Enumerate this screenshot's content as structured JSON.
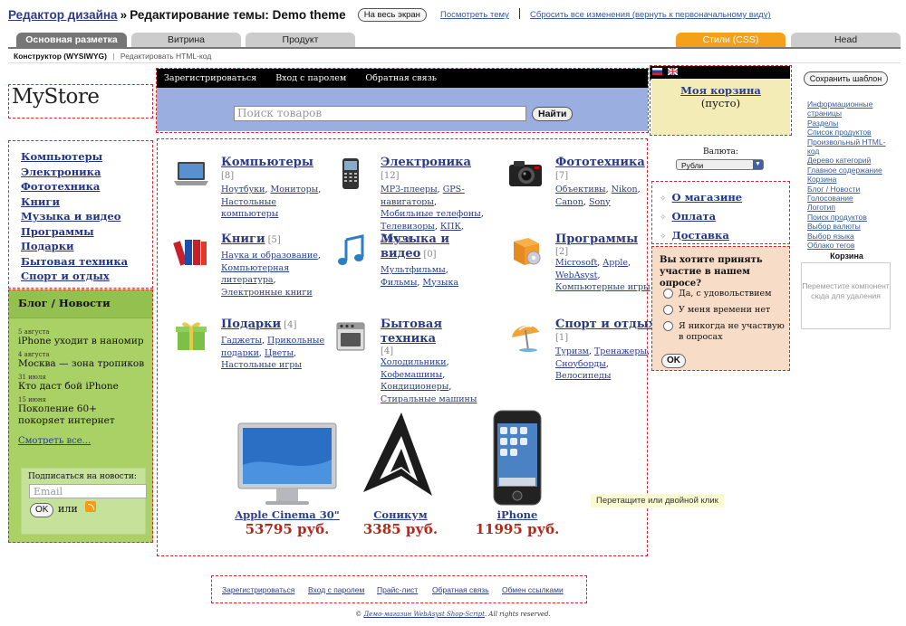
{
  "header": {
    "breadcrumb": "Редактор дизайна",
    "separator": "»",
    "title": "Редактирование темы: Demo theme",
    "fullscreen_label": "На весь экран",
    "view_theme_label": "Посмотреть тему",
    "reset_label": "Сбросить все изменения (вернуть к первоначальному виду)"
  },
  "tabs": [
    {
      "label": "Основная разметка"
    },
    {
      "label": "Витрина"
    },
    {
      "label": "Продукт"
    },
    {
      "label": "Стили (CSS)"
    },
    {
      "label": "Head"
    }
  ],
  "subtabs": {
    "wysiwyg": "Конструктор (WYSIWYG)",
    "sep": "|",
    "html": "Редактировать HTML-код"
  },
  "store": {
    "logo": "MyStore",
    "left_categories": [
      "Компьютеры",
      "Электроника",
      "Фототехника",
      "Книги",
      "Музыка и видео",
      "Программы",
      "Подарки",
      "Бытовая техника",
      "Спорт и отдых"
    ],
    "blog": {
      "title": "Блог / Новости",
      "entries": [
        {
          "date": "5 августа",
          "title": "iPhone уходит в наномир"
        },
        {
          "date": "4 августа",
          "title": "Москва — зона тропиков"
        },
        {
          "date": "31 июля",
          "title": "Кто даст бой iPhone"
        },
        {
          "date": "15 июня",
          "title": "Поколение 60+ покоряет интернет"
        }
      ],
      "see_all": "Смотреть все...",
      "subscribe_label": "Подписаться на новости:",
      "email_placeholder": "Email",
      "ok_label": "OK",
      "or_label": "или"
    },
    "top_nav": [
      "Зарегистрироваться",
      "Вход с паролем",
      "Обратная связь"
    ],
    "search": {
      "placeholder": "Поиск товаров",
      "button": "Найти"
    },
    "categories": [
      {
        "name": "Компьютеры",
        "count": "[8]",
        "subs": [
          "Ноутбуки",
          ", ",
          "Мониторы",
          ", ",
          "Настольные компьютеры"
        ],
        "icon": "laptop-icon"
      },
      {
        "name": "Электроника",
        "count": "[12]",
        "subs": [
          "MP3-плееры",
          ", ",
          "GPS-навигаторы",
          ", ",
          "Мобильные телефоны",
          ", ",
          "Телевизоры",
          ", ",
          "КПК",
          ", ",
          "Другое"
        ],
        "icon": "mobile-phone-icon"
      },
      {
        "name": "Фототехника",
        "count": "[7]",
        "subs": [
          "Объективы",
          ", ",
          "Nikon",
          ", ",
          "Canon",
          ", ",
          "Sony"
        ],
        "icon": "camera-icon"
      },
      {
        "name": "Книги",
        "count": "[5]",
        "subs": [
          "Наука и образование",
          ", ",
          "Компьютерная литература",
          ", ",
          "Электронные книги"
        ],
        "icon": "books-icon"
      },
      {
        "name": "Музыка и видео",
        "count": "[0]",
        "subs": [
          "Мультфильмы",
          ", ",
          "Фильмы",
          ", ",
          "Музыка"
        ],
        "icon": "music-note-icon"
      },
      {
        "name": "Программы",
        "count": "[2]",
        "subs": [
          "Microsoft",
          ", ",
          "Apple",
          ", ",
          "WebAsyst",
          ", ",
          "Компьютерные игры"
        ],
        "icon": "software-box-icon"
      },
      {
        "name": "Подарки",
        "count": "[4]",
        "subs": [
          "Гаджеты",
          ", ",
          "Прикольные подарки",
          ", ",
          "Цветы",
          ", ",
          "Настольные игры"
        ],
        "icon": "gift-icon"
      },
      {
        "name": "Бытовая техника",
        "count": "[4]",
        "subs": [
          "Холодильники",
          ", ",
          "Кофемашины",
          ", ",
          "Кондиционеры",
          ", ",
          "Стиральные машины"
        ],
        "icon": "stove-icon"
      },
      {
        "name": "Спорт и отдых",
        "count": "[1]",
        "subs": [
          "Туризм",
          ", ",
          "Тренажеры",
          ", ",
          "Сноуборды",
          ", ",
          "Велосипеды"
        ],
        "icon": "beach-umbrella-icon"
      }
    ],
    "products": [
      {
        "name": "Apple Cinema 30\"",
        "price": "53795 руб."
      },
      {
        "name": "Соникум",
        "price": "3385 руб."
      },
      {
        "name": "iPhone",
        "price": "11995 руб."
      }
    ],
    "drag_tip": "Перетащите или двойной клик",
    "cart": {
      "title": "Моя корзина",
      "empty": "(пусто)"
    },
    "currency": {
      "label": "Валюта:",
      "selected": "Рубли"
    },
    "info_pages": [
      "О магазине",
      "Оплата",
      "Доставка"
    ],
    "poll": {
      "question": "Вы хотите принять участие в нашем опросе?",
      "options": [
        "Да, с удовольствием",
        "У меня времени нет",
        "Я никогда не участвую в опросах"
      ],
      "ok_label": "OK"
    },
    "footer_nav": [
      "Зарегистрироваться",
      "Вход с паролем",
      "Прайс-лист",
      "Обратная связь",
      "Обмен ссылками"
    ],
    "copyright_prefix": "©",
    "copyright_link": "Демо-магазин WebAsyst Shop-Script",
    "copyright_suffix": ". All rights reserved."
  },
  "sidebar": {
    "save_label": "Сохранить шаблон",
    "widgets": [
      "Информационные страницы",
      "Разделы",
      "Список продуктов",
      "Произвольный HTML-код",
      "Дерево категорий",
      "Главное содержание",
      "Корзина",
      "Блог / Новости",
      "Голосование",
      "Логотип",
      "Поиск продуктов",
      "Выбор валюты",
      "Выбор языка",
      "Облако тегов"
    ],
    "cart_widget_label": "Корзина",
    "dropzone_text": "Переместите компонент сюда для удаления"
  },
  "colors": {
    "accent_tab": "#f5a01a",
    "price": "#b52719",
    "dash_border": "#d9232d",
    "blog_bg": "#a9d165",
    "poll_bg": "#f7dcc7",
    "cart_bg": "#f3ecb7",
    "search_bg": "#9aaee0"
  }
}
